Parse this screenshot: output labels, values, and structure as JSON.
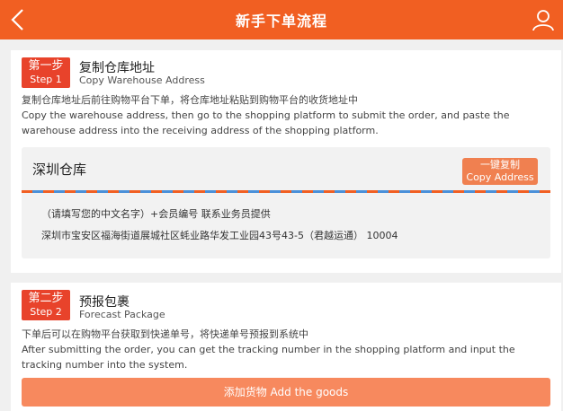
{
  "header": {
    "title": "新手下单流程",
    "back_icon": "chevron-left-icon",
    "user_icon": "user-icon"
  },
  "colors": {
    "brand": "#f15f22",
    "step_badge": "#e8432b",
    "button": "#f7895e"
  },
  "step1": {
    "badge_cn": "第一步",
    "badge_en": "Step 1",
    "title_cn": "复制仓库地址",
    "title_en": "Copy Warehouse Address",
    "desc_cn": "复制仓库地址后前往购物平台下单，将仓库地址粘贴到购物平台的收货地址中",
    "desc_en": "Copy the warehouse address, then go to the shopping platform to submit the order, and paste the warehouse address into the receiving address of the shopping platform.",
    "warehouse": {
      "name": "深圳仓库",
      "copy_button_cn": "一键复制",
      "copy_button_en": "Copy Address",
      "note": "（请填写您的中文名字）+会员编号  联系业务员提供",
      "address": "深圳市宝安区福海街道展城社区蚝业路华发工业园43号43-5（君越运通） 10004"
    }
  },
  "step2": {
    "badge_cn": "第二步",
    "badge_en": "Step 2",
    "title_cn": "预报包裹",
    "title_en": "Forecast Package",
    "desc_cn": "下单后可以在购物平台获取到快递单号，将快递单号预报到系统中",
    "desc_en": "After submitting the order, you can get the tracking number in the shopping platform and input the tracking number into the system.",
    "add_goods_button": "添加货物 Add the goods"
  }
}
